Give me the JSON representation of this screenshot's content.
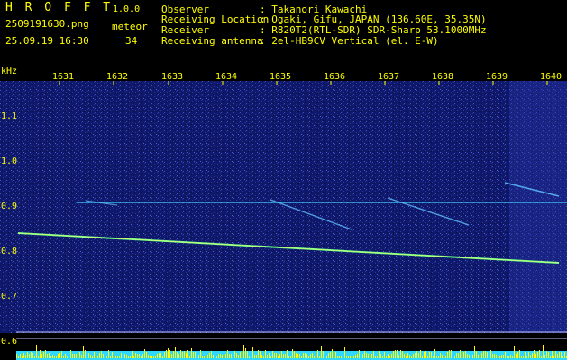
{
  "header": {
    "logo": "H R O F F T",
    "version": "1.0.0",
    "filename": "2509191630.png",
    "datetime": "25.09.19 16:30",
    "meteor_label": "meteor",
    "meteor_count": "34",
    "fields": [
      {
        "label": "Observer",
        "value": ": Takanori Kawachi"
      },
      {
        "label": "Receiving Location",
        "value": ": Ogaki, Gifu, JAPAN (136.60E, 35.35N)"
      },
      {
        "label": "Receiver",
        "value": ": R820T2(RTL-SDR) SDR-Sharp 53.1000MHz"
      },
      {
        "label": "Receiving antenna",
        "value": ": 2el-HB9CV Vertical (el. E-W)"
      }
    ]
  },
  "axis": {
    "unit": "kHz",
    "x_ticks": [
      "1631",
      "1632",
      "1633",
      "1634",
      "1635",
      "1636",
      "1637",
      "1638",
      "1639",
      "1640"
    ],
    "y_ticks": [
      "1.1",
      "1.0",
      "0.9",
      "0.8",
      "0.7",
      "0.6"
    ]
  },
  "colors": {
    "text": "#ffff00",
    "background": "#000000",
    "noise": "#1a2a8a",
    "bars": "#ffff00",
    "cyan": "#40e0ff"
  }
}
